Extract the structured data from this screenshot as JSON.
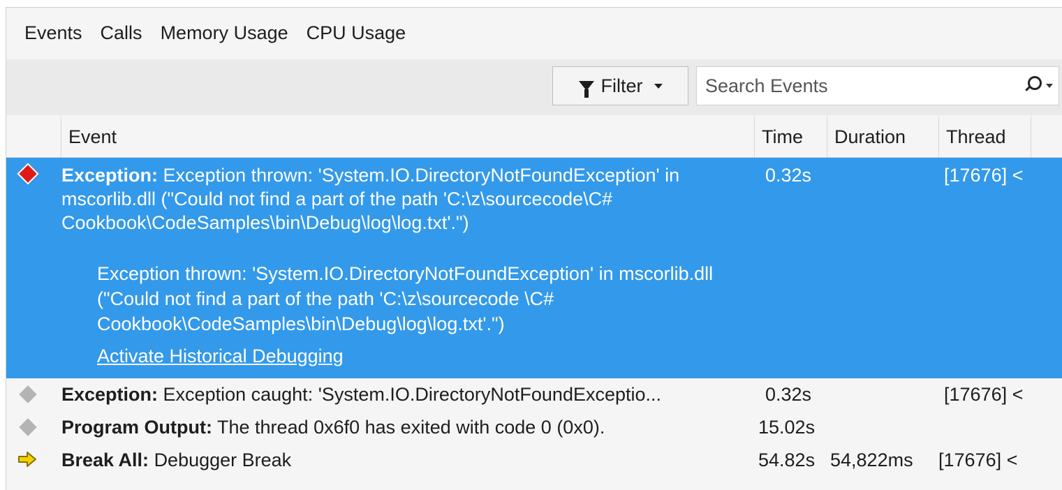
{
  "tabs": [
    "Events",
    "Calls",
    "Memory Usage",
    "CPU Usage"
  ],
  "toolbar": {
    "filter_label": "Filter",
    "search_placeholder": "Search Events"
  },
  "columns": {
    "event": "Event",
    "time": "Time",
    "duration": "Duration",
    "thread": "Thread"
  },
  "rows": [
    {
      "icon": "red-diamond-icon",
      "category": "Exception:",
      "text": "Exception thrown: 'System.IO.DirectoryNotFoundException' in mscorlib.dll (\"Could not find a part of the path 'C:\\z\\sourcecode\\C# Cookbook\\CodeSamples\\bin\\Debug\\log\\log.txt'.\")",
      "time": "0.32s",
      "duration": "",
      "thread": "[17676] <",
      "selected": true,
      "detail": "Exception thrown: 'System.IO.DirectoryNotFoundException' in mscorlib.dll (\"Could not find a part of the path 'C:\\z\\sourcecode \\C# Cookbook\\CodeSamples\\bin\\Debug\\log\\log.txt'.\")",
      "link": "Activate Historical Debugging"
    },
    {
      "icon": "grey-diamond-icon",
      "category": "Exception:",
      "text": "Exception caught: 'System.IO.DirectoryNotFoundExceptio...",
      "time": "0.32s",
      "duration": "",
      "thread": "[17676] <"
    },
    {
      "icon": "grey-diamond-icon",
      "category": "Program Output:",
      "text": "The thread 0x6f0 has exited with code 0 (0x0).",
      "time": "15.02s",
      "duration": "",
      "thread": ""
    },
    {
      "icon": "break-arrow-icon",
      "category": "Break All:",
      "text": "Debugger Break",
      "time": "54.82s",
      "duration": "54,822ms",
      "thread": "[17676] <"
    }
  ],
  "colors": {
    "selection": "#3399ea",
    "exception_red": "#e01a1a",
    "break_yellow": "#f5d000"
  }
}
